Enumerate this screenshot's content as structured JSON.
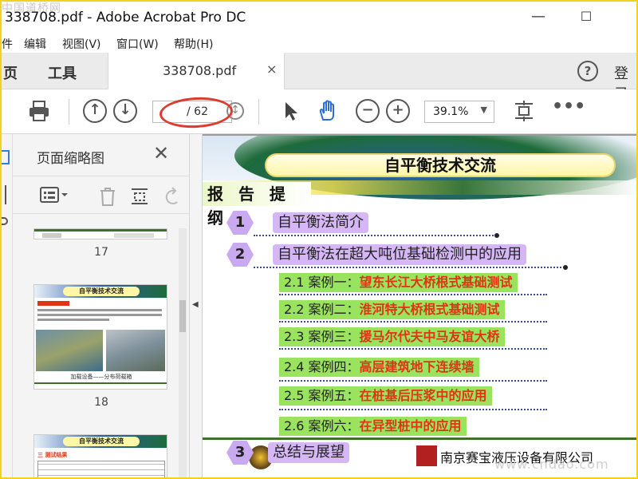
{
  "window": {
    "title": "338708.pdf - Adobe Acrobat Pro DC",
    "watermark_top": "中国道桥网",
    "minimize": "—",
    "maximize": "☐"
  },
  "menu": {
    "items": [
      "件",
      "编辑",
      "视图(V)",
      "窗口(W)",
      "帮助(H)"
    ]
  },
  "tabs": {
    "home": "页",
    "tools": "工具",
    "doc_tab": "338708.pdf",
    "close": "×",
    "help": "?",
    "login": "登录"
  },
  "toolbar": {
    "current_page": "",
    "total_pages": "/ 62",
    "zoom": "39.1%"
  },
  "panel": {
    "title": "页面缩略图",
    "thumbnails": [
      {
        "page": "17",
        "title": ""
      },
      {
        "page": "18",
        "title": "自平衡技术交流",
        "caption": "加载设备——分布荷载箱"
      },
      {
        "page": "",
        "title": "自平衡技术交流",
        "caption": "三 测试结果"
      }
    ]
  },
  "slide": {
    "title": "自平衡技术交流",
    "section_label": "报 告 提 纲",
    "items": [
      {
        "num": "1",
        "text": "自平衡法简介"
      },
      {
        "num": "2",
        "text": "自平衡法在超大吨位基础检测中的应用"
      },
      {
        "num": "3",
        "text": "总结与展望"
      }
    ],
    "cases": [
      {
        "prefix": "2.1 案例一：",
        "name": "望东长江大桥根式基础测试"
      },
      {
        "prefix": "2.2 案例二：",
        "name": "淮河特大桥根式基础测试"
      },
      {
        "prefix": "2.3 案例三：",
        "name": "援马尔代夫中马友谊大桥"
      },
      {
        "prefix": "2.4 案例四：",
        "name": "高层建筑地下连续墙"
      },
      {
        "prefix": "2.5 案例五：",
        "name": "在桩基后压浆中的应用"
      },
      {
        "prefix": "2.6 案例六：",
        "name": "在异型桩中的应用"
      }
    ],
    "company": "南京赛宝液压设备有限公司"
  },
  "watermark_br": "www.cndao.com",
  "colors": {
    "frame_border": "#f2d21b",
    "annotation_red": "#e0392f",
    "case_green": "#9ae35f",
    "item_purple": "#d5b7f5",
    "case_name_red": "#e03414"
  },
  "icons": [
    "print-icon",
    "prev-page-icon",
    "next-page-icon",
    "select-arrow-icon",
    "hand-icon",
    "zoom-out-icon",
    "zoom-in-icon",
    "fit-page-icon",
    "more-icon",
    "bookmark-icon",
    "options-icon",
    "delete-icon",
    "extract-icon",
    "undo-icon",
    "help-icon",
    "close-icon"
  ]
}
